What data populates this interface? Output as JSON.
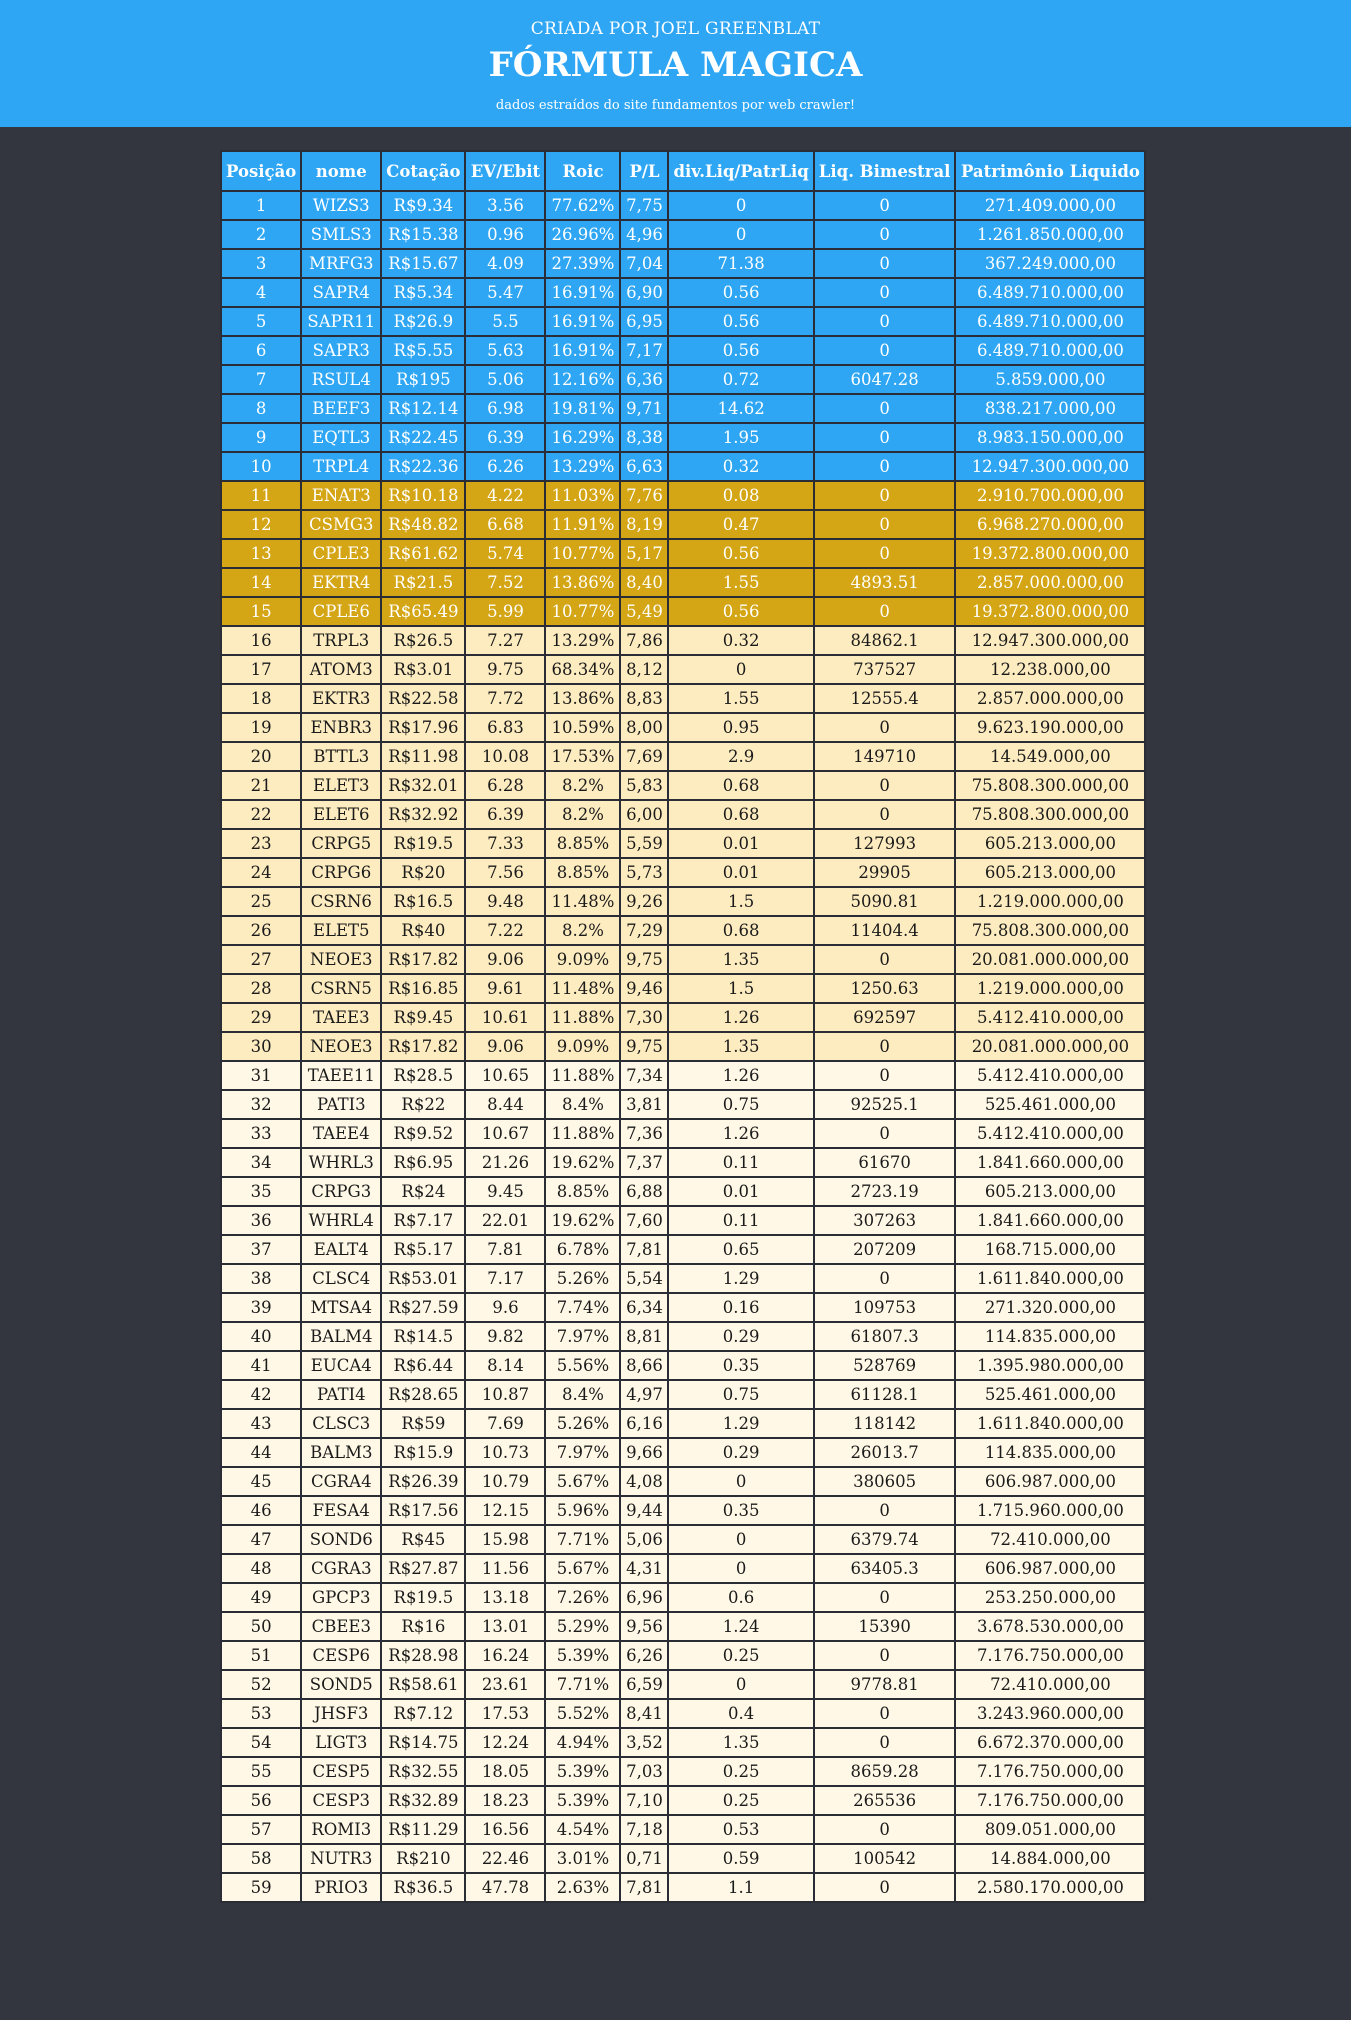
{
  "header": {
    "subtitle": "CRIADA POR JOEL GREENBLAT",
    "title": "FÓRMULA MAGICA",
    "note": "dados estraídos do site fundamentos por web crawler!"
  },
  "colors": {
    "header_bg": "#2ea6f4",
    "page_bg": "#33363f",
    "tier_blue": "#2ea6f4",
    "tier_gold": "#d4a514",
    "tier_light": "#fdecc0",
    "tier_cream": "#fff8e6"
  },
  "table": {
    "columns": [
      "Posição",
      "nome",
      "Cotação",
      "EV/Ebit",
      "Roic",
      "P/L",
      "div.Liq/PatrLiq",
      "Liq. Bimestral",
      "Patrimônio Liquido"
    ],
    "rows": [
      [
        "1",
        "WIZS3",
        "R$9.34",
        "3.56",
        "77.62%",
        "7,75",
        "0",
        "0",
        "271.409.000,00"
      ],
      [
        "2",
        "SMLS3",
        "R$15.38",
        "0.96",
        "26.96%",
        "4,96",
        "0",
        "0",
        "1.261.850.000,00"
      ],
      [
        "3",
        "MRFG3",
        "R$15.67",
        "4.09",
        "27.39%",
        "7,04",
        "71.38",
        "0",
        "367.249.000,00"
      ],
      [
        "4",
        "SAPR4",
        "R$5.34",
        "5.47",
        "16.91%",
        "6,90",
        "0.56",
        "0",
        "6.489.710.000,00"
      ],
      [
        "5",
        "SAPR11",
        "R$26.9",
        "5.5",
        "16.91%",
        "6,95",
        "0.56",
        "0",
        "6.489.710.000,00"
      ],
      [
        "6",
        "SAPR3",
        "R$5.55",
        "5.63",
        "16.91%",
        "7,17",
        "0.56",
        "0",
        "6.489.710.000,00"
      ],
      [
        "7",
        "RSUL4",
        "R$195",
        "5.06",
        "12.16%",
        "6,36",
        "0.72",
        "6047.28",
        "5.859.000,00"
      ],
      [
        "8",
        "BEEF3",
        "R$12.14",
        "6.98",
        "19.81%",
        "9,71",
        "14.62",
        "0",
        "838.217.000,00"
      ],
      [
        "9",
        "EQTL3",
        "R$22.45",
        "6.39",
        "16.29%",
        "8,38",
        "1.95",
        "0",
        "8.983.150.000,00"
      ],
      [
        "10",
        "TRPL4",
        "R$22.36",
        "6.26",
        "13.29%",
        "6,63",
        "0.32",
        "0",
        "12.947.300.000,00"
      ],
      [
        "11",
        "ENAT3",
        "R$10.18",
        "4.22",
        "11.03%",
        "7,76",
        "0.08",
        "0",
        "2.910.700.000,00"
      ],
      [
        "12",
        "CSMG3",
        "R$48.82",
        "6.68",
        "11.91%",
        "8,19",
        "0.47",
        "0",
        "6.968.270.000,00"
      ],
      [
        "13",
        "CPLE3",
        "R$61.62",
        "5.74",
        "10.77%",
        "5,17",
        "0.56",
        "0",
        "19.372.800.000,00"
      ],
      [
        "14",
        "EKTR4",
        "R$21.5",
        "7.52",
        "13.86%",
        "8,40",
        "1.55",
        "4893.51",
        "2.857.000.000,00"
      ],
      [
        "15",
        "CPLE6",
        "R$65.49",
        "5.99",
        "10.77%",
        "5,49",
        "0.56",
        "0",
        "19.372.800.000,00"
      ],
      [
        "16",
        "TRPL3",
        "R$26.5",
        "7.27",
        "13.29%",
        "7,86",
        "0.32",
        "84862.1",
        "12.947.300.000,00"
      ],
      [
        "17",
        "ATOM3",
        "R$3.01",
        "9.75",
        "68.34%",
        "8,12",
        "0",
        "737527",
        "12.238.000,00"
      ],
      [
        "18",
        "EKTR3",
        "R$22.58",
        "7.72",
        "13.86%",
        "8,83",
        "1.55",
        "12555.4",
        "2.857.000.000,00"
      ],
      [
        "19",
        "ENBR3",
        "R$17.96",
        "6.83",
        "10.59%",
        "8,00",
        "0.95",
        "0",
        "9.623.190.000,00"
      ],
      [
        "20",
        "BTTL3",
        "R$11.98",
        "10.08",
        "17.53%",
        "7,69",
        "2.9",
        "149710",
        "14.549.000,00"
      ],
      [
        "21",
        "ELET3",
        "R$32.01",
        "6.28",
        "8.2%",
        "5,83",
        "0.68",
        "0",
        "75.808.300.000,00"
      ],
      [
        "22",
        "ELET6",
        "R$32.92",
        "6.39",
        "8.2%",
        "6,00",
        "0.68",
        "0",
        "75.808.300.000,00"
      ],
      [
        "23",
        "CRPG5",
        "R$19.5",
        "7.33",
        "8.85%",
        "5,59",
        "0.01",
        "127993",
        "605.213.000,00"
      ],
      [
        "24",
        "CRPG6",
        "R$20",
        "7.56",
        "8.85%",
        "5,73",
        "0.01",
        "29905",
        "605.213.000,00"
      ],
      [
        "25",
        "CSRN6",
        "R$16.5",
        "9.48",
        "11.48%",
        "9,26",
        "1.5",
        "5090.81",
        "1.219.000.000,00"
      ],
      [
        "26",
        "ELET5",
        "R$40",
        "7.22",
        "8.2%",
        "7,29",
        "0.68",
        "11404.4",
        "75.808.300.000,00"
      ],
      [
        "27",
        "NEOE3",
        "R$17.82",
        "9.06",
        "9.09%",
        "9,75",
        "1.35",
        "0",
        "20.081.000.000,00"
      ],
      [
        "28",
        "CSRN5",
        "R$16.85",
        "9.61",
        "11.48%",
        "9,46",
        "1.5",
        "1250.63",
        "1.219.000.000,00"
      ],
      [
        "29",
        "TAEE3",
        "R$9.45",
        "10.61",
        "11.88%",
        "7,30",
        "1.26",
        "692597",
        "5.412.410.000,00"
      ],
      [
        "30",
        "NEOE3",
        "R$17.82",
        "9.06",
        "9.09%",
        "9,75",
        "1.35",
        "0",
        "20.081.000.000,00"
      ],
      [
        "31",
        "TAEE11",
        "R$28.5",
        "10.65",
        "11.88%",
        "7,34",
        "1.26",
        "0",
        "5.412.410.000,00"
      ],
      [
        "32",
        "PATI3",
        "R$22",
        "8.44",
        "8.4%",
        "3,81",
        "0.75",
        "92525.1",
        "525.461.000,00"
      ],
      [
        "33",
        "TAEE4",
        "R$9.52",
        "10.67",
        "11.88%",
        "7,36",
        "1.26",
        "0",
        "5.412.410.000,00"
      ],
      [
        "34",
        "WHRL3",
        "R$6.95",
        "21.26",
        "19.62%",
        "7,37",
        "0.11",
        "61670",
        "1.841.660.000,00"
      ],
      [
        "35",
        "CRPG3",
        "R$24",
        "9.45",
        "8.85%",
        "6,88",
        "0.01",
        "2723.19",
        "605.213.000,00"
      ],
      [
        "36",
        "WHRL4",
        "R$7.17",
        "22.01",
        "19.62%",
        "7,60",
        "0.11",
        "307263",
        "1.841.660.000,00"
      ],
      [
        "37",
        "EALT4",
        "R$5.17",
        "7.81",
        "6.78%",
        "7,81",
        "0.65",
        "207209",
        "168.715.000,00"
      ],
      [
        "38",
        "CLSC4",
        "R$53.01",
        "7.17",
        "5.26%",
        "5,54",
        "1.29",
        "0",
        "1.611.840.000,00"
      ],
      [
        "39",
        "MTSA4",
        "R$27.59",
        "9.6",
        "7.74%",
        "6,34",
        "0.16",
        "109753",
        "271.320.000,00"
      ],
      [
        "40",
        "BALM4",
        "R$14.5",
        "9.82",
        "7.97%",
        "8,81",
        "0.29",
        "61807.3",
        "114.835.000,00"
      ],
      [
        "41",
        "EUCA4",
        "R$6.44",
        "8.14",
        "5.56%",
        "8,66",
        "0.35",
        "528769",
        "1.395.980.000,00"
      ],
      [
        "42",
        "PATI4",
        "R$28.65",
        "10.87",
        "8.4%",
        "4,97",
        "0.75",
        "61128.1",
        "525.461.000,00"
      ],
      [
        "43",
        "CLSC3",
        "R$59",
        "7.69",
        "5.26%",
        "6,16",
        "1.29",
        "118142",
        "1.611.840.000,00"
      ],
      [
        "44",
        "BALM3",
        "R$15.9",
        "10.73",
        "7.97%",
        "9,66",
        "0.29",
        "26013.7",
        "114.835.000,00"
      ],
      [
        "45",
        "CGRA4",
        "R$26.39",
        "10.79",
        "5.67%",
        "4,08",
        "0",
        "380605",
        "606.987.000,00"
      ],
      [
        "46",
        "FESA4",
        "R$17.56",
        "12.15",
        "5.96%",
        "9,44",
        "0.35",
        "0",
        "1.715.960.000,00"
      ],
      [
        "47",
        "SOND6",
        "R$45",
        "15.98",
        "7.71%",
        "5,06",
        "0",
        "6379.74",
        "72.410.000,00"
      ],
      [
        "48",
        "CGRA3",
        "R$27.87",
        "11.56",
        "5.67%",
        "4,31",
        "0",
        "63405.3",
        "606.987.000,00"
      ],
      [
        "49",
        "GPCP3",
        "R$19.5",
        "13.18",
        "7.26%",
        "6,96",
        "0.6",
        "0",
        "253.250.000,00"
      ],
      [
        "50",
        "CBEE3",
        "R$16",
        "13.01",
        "5.29%",
        "9,56",
        "1.24",
        "15390",
        "3.678.530.000,00"
      ],
      [
        "51",
        "CESP6",
        "R$28.98",
        "16.24",
        "5.39%",
        "6,26",
        "0.25",
        "0",
        "7.176.750.000,00"
      ],
      [
        "52",
        "SOND5",
        "R$58.61",
        "23.61",
        "7.71%",
        "6,59",
        "0",
        "9778.81",
        "72.410.000,00"
      ],
      [
        "53",
        "JHSF3",
        "R$7.12",
        "17.53",
        "5.52%",
        "8,41",
        "0.4",
        "0",
        "3.243.960.000,00"
      ],
      [
        "54",
        "LIGT3",
        "R$14.75",
        "12.24",
        "4.94%",
        "3,52",
        "1.35",
        "0",
        "6.672.370.000,00"
      ],
      [
        "55",
        "CESP5",
        "R$32.55",
        "18.05",
        "5.39%",
        "7,03",
        "0.25",
        "8659.28",
        "7.176.750.000,00"
      ],
      [
        "56",
        "CESP3",
        "R$32.89",
        "18.23",
        "5.39%",
        "7,10",
        "0.25",
        "265536",
        "7.176.750.000,00"
      ],
      [
        "57",
        "ROMI3",
        "R$11.29",
        "16.56",
        "4.54%",
        "7,18",
        "0.53",
        "0",
        "809.051.000,00"
      ],
      [
        "58",
        "NUTR3",
        "R$210",
        "22.46",
        "3.01%",
        "0,71",
        "0.59",
        "100542",
        "14.884.000,00"
      ],
      [
        "59",
        "PRIO3",
        "R$36.5",
        "47.78",
        "2.63%",
        "7,81",
        "1.1",
        "0",
        "2.580.170.000,00"
      ]
    ]
  }
}
